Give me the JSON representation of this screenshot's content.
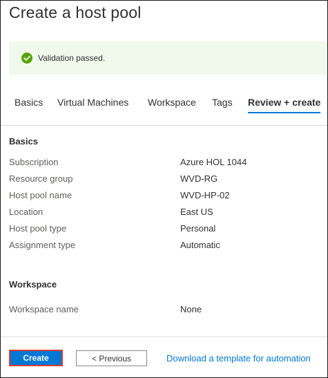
{
  "page": {
    "title": "Create a host pool"
  },
  "validation": {
    "message": "Validation passed.",
    "status_color": "#57a300",
    "background": "#f1f8ec",
    "icon": "check-circle-icon"
  },
  "tabs": [
    {
      "label": "Basics",
      "active": false
    },
    {
      "label": "Virtual Machines",
      "active": false
    },
    {
      "label": "Workspace",
      "active": false
    },
    {
      "label": "Tags",
      "active": false
    },
    {
      "label": "Review + create",
      "active": true
    }
  ],
  "accent_color": "#0078d4",
  "sections": {
    "basics": {
      "title": "Basics",
      "rows": [
        {
          "label": "Subscription",
          "value": "Azure HOL 1044"
        },
        {
          "label": "Resource group",
          "value": "WVD-RG"
        },
        {
          "label": "Host pool name",
          "value": "WVD-HP-02"
        },
        {
          "label": "Location",
          "value": "East US"
        },
        {
          "label": "Host pool type",
          "value": "Personal"
        },
        {
          "label": "Assignment type",
          "value": "Automatic"
        }
      ]
    },
    "workspace": {
      "title": "Workspace",
      "rows": [
        {
          "label": "Workspace name",
          "value": "None"
        }
      ]
    }
  },
  "footer": {
    "create_label": "Create",
    "previous_label": "< Previous",
    "template_link": "Download a template for automation"
  }
}
